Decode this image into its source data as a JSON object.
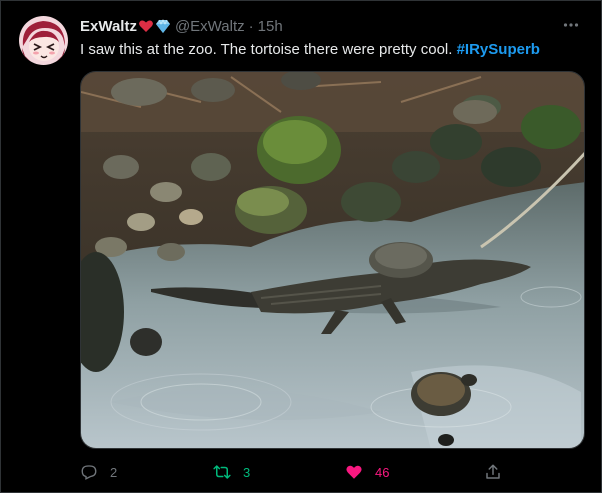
{
  "tweet": {
    "display_name": "ExWaltz",
    "handle": "@ExWaltz",
    "separator": "·",
    "time": "15h",
    "text_main": "I saw this at the zoo. The tortoise there were pretty cool.",
    "hashtag": "#IRySuperb"
  },
  "icons": {
    "name_badges": [
      "red-heart-icon",
      "gem-icon"
    ],
    "more": "more-icon",
    "reply": "reply-icon",
    "retweet": "retweet-icon",
    "like": "like-icon",
    "share": "share-icon"
  },
  "actions": {
    "reply_count": "2",
    "retweet_count": "3",
    "like_count": "46"
  },
  "colors": {
    "background": "#000000",
    "text": "#e7e9ea",
    "muted": "#71767b",
    "link": "#1d9bf0",
    "retweet_active": "#00ba7c",
    "like_active": "#f91880"
  }
}
